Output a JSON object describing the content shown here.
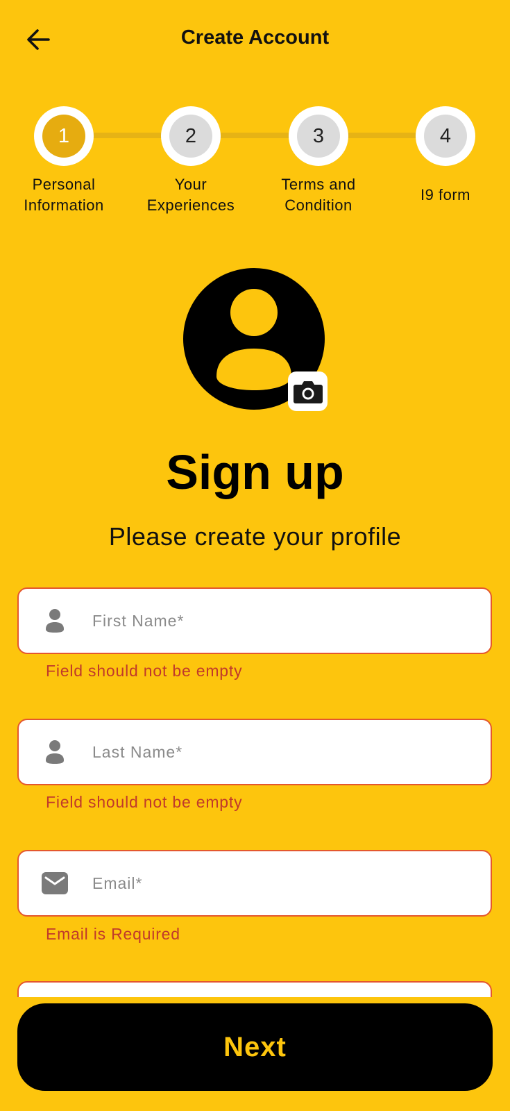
{
  "header": {
    "title": "Create Account",
    "back_icon": "arrow-left-icon"
  },
  "stepper": {
    "active_step": 1,
    "steps": [
      {
        "number": "1",
        "label_line1": "Personal",
        "label_line2": "Information"
      },
      {
        "number": "2",
        "label_line1": "Your",
        "label_line2": "Experiences"
      },
      {
        "number": "3",
        "label_line1": "Terms and",
        "label_line2": "Condition"
      },
      {
        "number": "4",
        "label_line1": "I9 form",
        "label_line2": ""
      }
    ]
  },
  "avatar": {
    "icon": "user-avatar-icon",
    "camera_icon": "camera-icon"
  },
  "main": {
    "title": "Sign up",
    "subtitle": "Please create your profile"
  },
  "form": {
    "first_name": {
      "placeholder": "First Name*",
      "value": "",
      "icon": "person-icon",
      "error": "Field should not be empty"
    },
    "last_name": {
      "placeholder": "Last Name*",
      "value": "",
      "icon": "person-icon",
      "error": "Field should not be empty"
    },
    "email": {
      "placeholder": "Email*",
      "value": "",
      "icon": "mail-icon",
      "error": "Email is Required"
    }
  },
  "footer": {
    "next_label": "Next"
  },
  "colors": {
    "background": "#FDC50D",
    "active_step": "#E6AC10",
    "error": "#C0392B",
    "field_border": "#E4572E",
    "button_bg": "#000000",
    "button_text": "#FDC50D"
  }
}
